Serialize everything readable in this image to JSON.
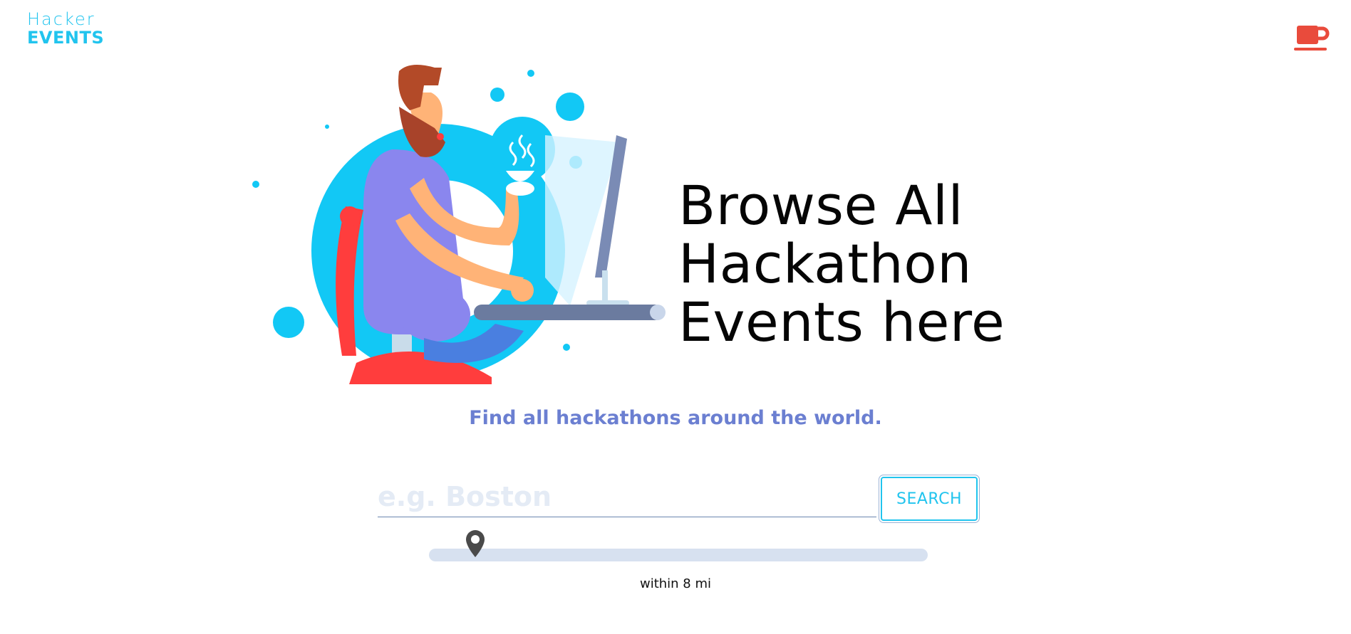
{
  "header": {
    "logo_line1": "Hacker",
    "logo_line2": "EVENTS",
    "coffee_icon": "coffee-cup-icon"
  },
  "hero": {
    "title": "Browse All Hackathon Events here",
    "subtitle": "Find all hackathons around the world.",
    "illustration": "developer-at-computer-illustration"
  },
  "search": {
    "placeholder": "e.g. Boston",
    "value": "",
    "button_label": "SEARCH"
  },
  "radius": {
    "label": "within 8 mi",
    "value_mi": 8,
    "thumb_icon": "map-pin-icon"
  },
  "colors": {
    "brand": "#21c4ee",
    "subtitle": "#6b7fd1",
    "accent": "#e94b3c",
    "track": "#d7e1f0"
  }
}
